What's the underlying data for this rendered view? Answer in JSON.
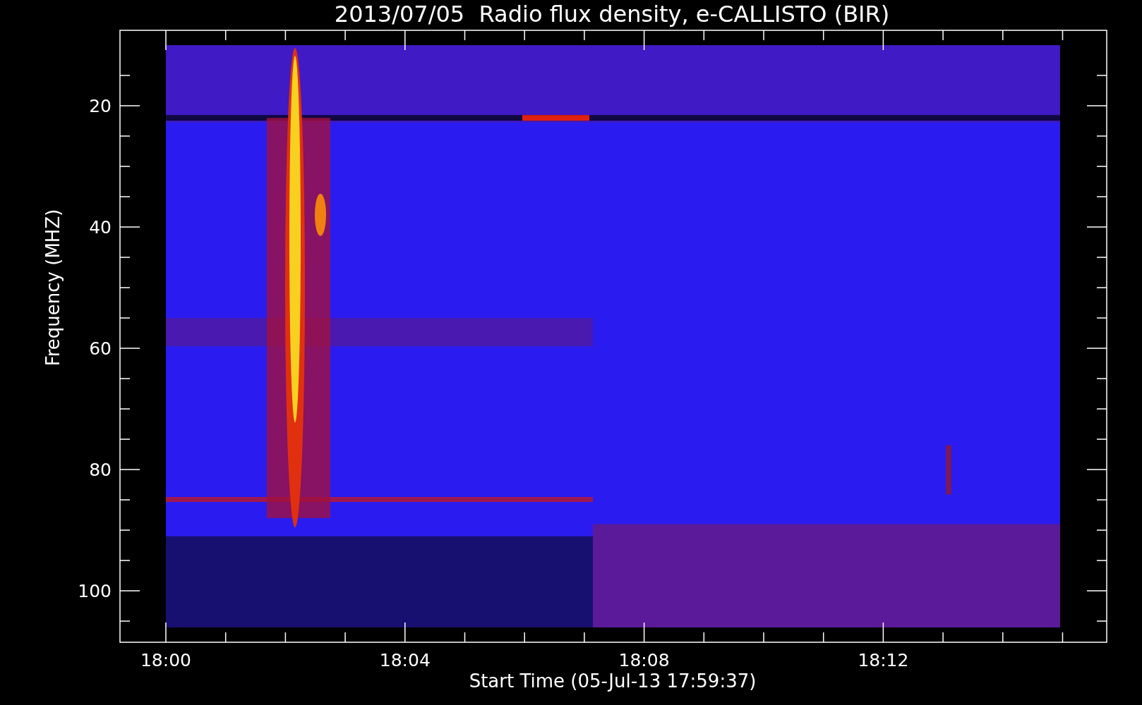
{
  "title": "2013/07/05  Radio flux density, e-CALLISTO (BIR)",
  "y_axis": {
    "label": "Frequency (MHZ)",
    "ticks": [
      "20",
      "40",
      "60",
      "80",
      "100"
    ]
  },
  "x_axis": {
    "label": "Start Time (05-Jul-13 17:59:37)",
    "ticks": [
      "18:00",
      "18:04",
      "18:08",
      "18:12"
    ]
  }
}
